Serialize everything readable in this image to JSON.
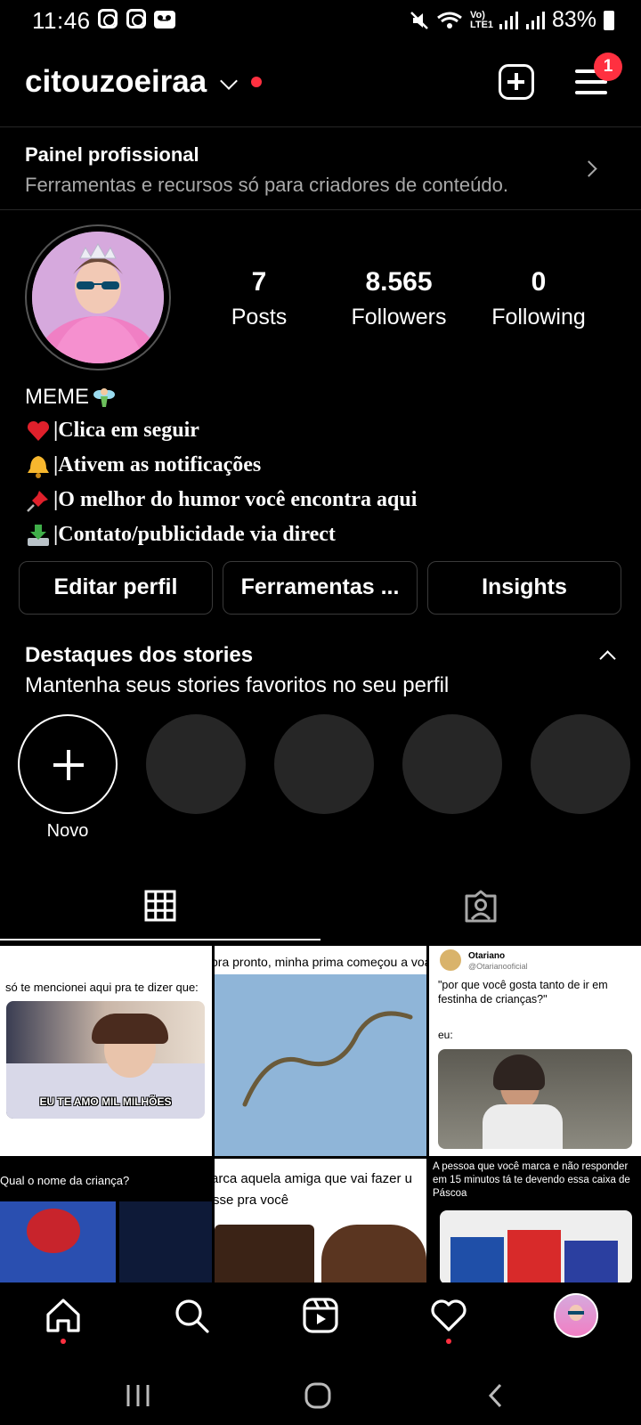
{
  "status_bar": {
    "time": "11:46",
    "network": "Vo) LTE1",
    "battery": "83%"
  },
  "header": {
    "username": "citouzoeiraa",
    "notification_count": "1"
  },
  "professional_panel": {
    "title": "Painel profissional",
    "subtitle": "Ferramentas e recursos só para criadores de conteúdo."
  },
  "stats": [
    {
      "value": "7",
      "label": "Posts"
    },
    {
      "value": "8.565",
      "label": "Followers"
    },
    {
      "value": "0",
      "label": "Following"
    }
  ],
  "bio": {
    "name": "MEME",
    "lines": [
      {
        "emoji": "heart-icon",
        "text": "|Clica em seguir"
      },
      {
        "emoji": "bell-icon",
        "text": "|Ativem as notificações"
      },
      {
        "emoji": "pushpin-icon",
        "text": "|O melhor do humor você encontra aqui"
      },
      {
        "emoji": "inbox-tray-icon",
        "text": "|Contato/publicidade via direct"
      }
    ]
  },
  "buttons": {
    "edit_profile": "Editar perfil",
    "tools": "Ferramentas ...",
    "insights": "Insights"
  },
  "highlights": {
    "title": "Destaques dos stories",
    "subtitle": "Mantenha seus stories favoritos no seu perfil",
    "new_label": "Novo"
  },
  "posts": [
    {
      "caption": "só te mencionei aqui pra te dizer que:",
      "image_text": "EU TE AMO MIL MILHÕES"
    },
    {
      "caption": "pra pronto, minha prima começou a voar"
    },
    {
      "author": "Otariano",
      "handle": "@Otarianooficial",
      "caption": "\"por que você gosta tanto de ir em festinha de crianças?\"",
      "caption_2": "eu:"
    },
    {
      "caption": "Qual o nome da criança?"
    },
    {
      "caption": "arca aquela amiga que vai fazer u",
      "caption_2": "sse pra você"
    },
    {
      "caption": "A pessoa que você marca e não responder em 15 minutos tá te devendo essa caixa de Páscoa"
    }
  ],
  "colors": {
    "background": "#000000",
    "accent_red": "#ff3040",
    "secondary_text": "#a8a8a8",
    "empty_highlight": "#262626"
  }
}
